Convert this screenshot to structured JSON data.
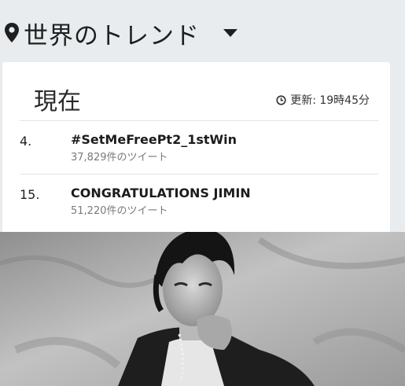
{
  "header": {
    "title": "世界のトレンド",
    "location_icon": "map-pin-icon",
    "dropdown_icon": "caret-down-icon"
  },
  "panel": {
    "heading": "現在",
    "updated_icon": "clock-icon",
    "updated_text": "更新: 19時45分"
  },
  "trends": [
    {
      "rank": "4.",
      "name": "#SetMeFreePt2_1stWin",
      "count": "37,829件のツイート"
    },
    {
      "rank": "15.",
      "name": "CONGRATULATIONS JIMIN",
      "count": "51,220件のツイート"
    }
  ],
  "photo": {
    "description_icon": "person-photo",
    "colors": {
      "background": "#a9a9a9",
      "dark": "#1e1e1e"
    }
  }
}
